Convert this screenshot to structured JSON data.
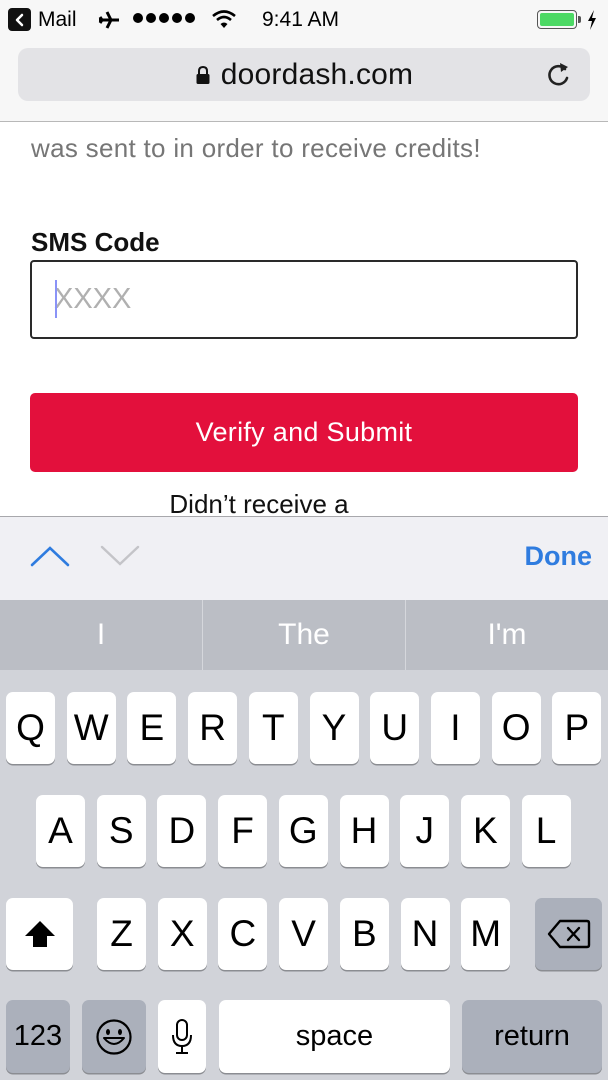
{
  "status_bar": {
    "back_app": "Mail",
    "time": "9:41 AM",
    "battery_level": 1.0,
    "charging": true,
    "signal_bars": 5,
    "icons": [
      "back-icon",
      "airplane-icon",
      "signal-dots-icon",
      "wifi-icon",
      "battery-icon",
      "charging-bolt-icon"
    ]
  },
  "browser": {
    "url": "doordash.com",
    "secure": true,
    "reload_icon": "reload-icon"
  },
  "page": {
    "intro_text": "was sent to in order to receive credits!",
    "sms_label": "SMS Code",
    "sms_input": {
      "value": "",
      "placeholder": "XXXX"
    },
    "submit_label": "Verify and Submit",
    "resend_text": "Didn’t receive a",
    "brand_color": "#e3103c"
  },
  "accessory_bar": {
    "prev_icon": "chevron-up-icon",
    "next_icon": "chevron-down-icon",
    "done_label": "Done"
  },
  "predictive": {
    "suggestions": [
      "I",
      "The",
      "I'm"
    ]
  },
  "keyboard": {
    "row1": [
      "Q",
      "W",
      "E",
      "R",
      "T",
      "Y",
      "U",
      "I",
      "O",
      "P"
    ],
    "row2": [
      "A",
      "S",
      "D",
      "F",
      "G",
      "H",
      "J",
      "K",
      "L"
    ],
    "row3": [
      "Z",
      "X",
      "C",
      "V",
      "B",
      "N",
      "M"
    ],
    "numbers_label": "123",
    "space_label": "space",
    "return_label": "return"
  }
}
